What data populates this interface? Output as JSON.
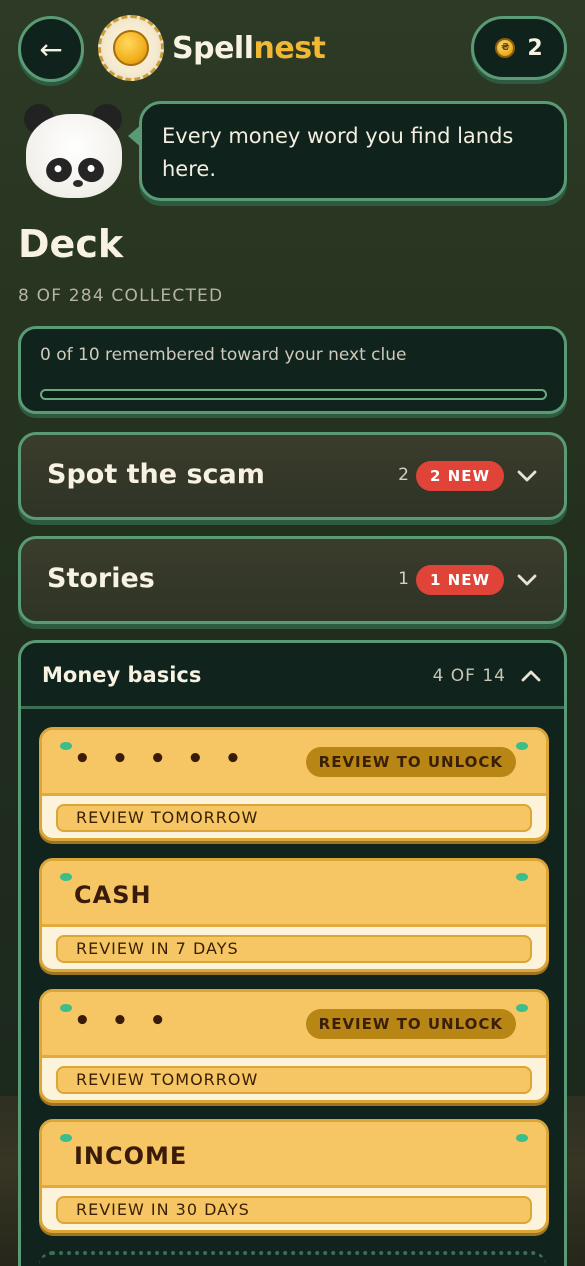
{
  "header": {
    "back_icon": "arrow-left-icon",
    "logo_part1": "Spell",
    "logo_part2": "nest",
    "coin_symbol": "₴",
    "coins": "2"
  },
  "mascot": {
    "speech": "Every money word you find lands here."
  },
  "page": {
    "title": "Deck",
    "subtitle": "8 OF 284 COLLECTED"
  },
  "progress": {
    "label": "0 of 10 remembered toward your next clue",
    "remembered": 0,
    "target": 10
  },
  "sections": [
    {
      "title": "Spot the scam",
      "count": "2",
      "badge": "2 NEW"
    },
    {
      "title": "Stories",
      "count": "1",
      "badge": "1 NEW"
    }
  ],
  "open_section": {
    "title": "Money basics",
    "count": "4 OF 14",
    "cards": [
      {
        "word": "• • • • •",
        "locked": true,
        "unlock_label": "REVIEW TO UNLOCK",
        "review": "REVIEW TOMORROW"
      },
      {
        "word": "CASH",
        "locked": false,
        "review": "REVIEW IN 7 DAYS"
      },
      {
        "word": "• • •",
        "locked": true,
        "unlock_label": "REVIEW TO UNLOCK",
        "review": "REVIEW TOMORROW"
      },
      {
        "word": "INCOME",
        "locked": false,
        "review": "REVIEW IN 30 DAYS"
      }
    ]
  },
  "colors": {
    "accent": "#f2b834",
    "frame": "#5a9b75",
    "new_badge": "#e04438",
    "card": "#f5c663"
  }
}
